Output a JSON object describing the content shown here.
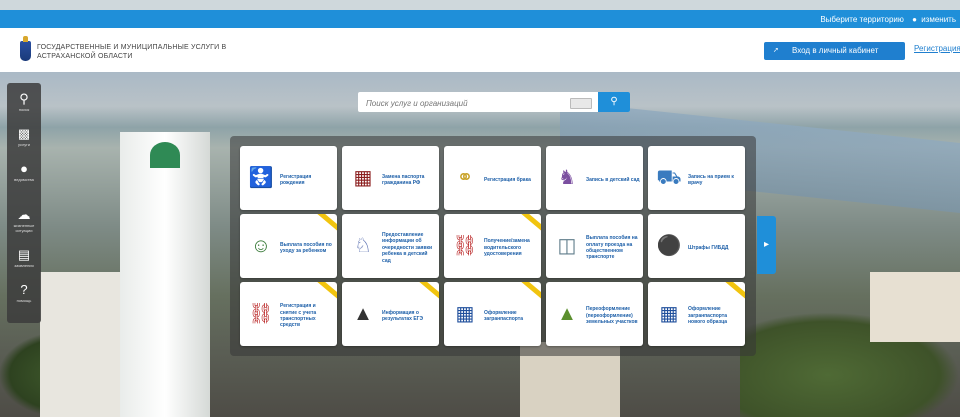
{
  "topbar": {
    "region_label": "Выберите территорию",
    "change_label": "изменить"
  },
  "header": {
    "site_name": "Государственные и муниципальные услуги в Астраханской области",
    "login_label": "Вход в личный кабинет",
    "register_label": "Регистрация"
  },
  "sidebar": {
    "items": [
      {
        "label": "поиск",
        "icon": "search-icon"
      },
      {
        "label": "услуги",
        "icon": "book-icon"
      },
      {
        "label": "ведомства",
        "icon": "globe-icon"
      },
      {
        "label": "жизненные ситуации",
        "icon": "weather-icon"
      },
      {
        "label": "заявления",
        "icon": "document-icon"
      },
      {
        "label": "помощь",
        "icon": "help-icon"
      }
    ]
  },
  "search": {
    "placeholder": "Поиск услуг и организаций"
  },
  "tiles": [
    {
      "label": "Регистрация рождения",
      "icon": "stroller-icon",
      "ribbon": false
    },
    {
      "label": "Замена паспорта гражданина РФ",
      "icon": "passport-icon",
      "ribbon": false
    },
    {
      "label": "Регистрация брака",
      "icon": "rings-icon",
      "ribbon": false
    },
    {
      "label": "Запись в детский сад",
      "icon": "kindergarten-icon",
      "ribbon": false
    },
    {
      "label": "Запись на прием к врачу",
      "icon": "ambulance-icon",
      "ribbon": false
    },
    {
      "label": "Выплата пособия по уходу за ребенком",
      "icon": "family-icon",
      "ribbon": true
    },
    {
      "label": "Предоставление информации об очередности заявки ребенка в детский сад",
      "icon": "rocking-horse-icon",
      "ribbon": false
    },
    {
      "label": "Получение/замена водительского удостоверения",
      "icon": "car-icon",
      "ribbon": true
    },
    {
      "label": "Выплата пособия на оплату проезда на общественном транспорте",
      "icon": "money-icon",
      "ribbon": false
    },
    {
      "label": "Штрафы ГИБДД",
      "icon": "traffic-light-icon",
      "ribbon": false
    },
    {
      "label": "Регистрация и снятие с учета транспортных средств",
      "icon": "car-icon",
      "ribbon": true
    },
    {
      "label": "Информация о результатах ЕГЭ",
      "icon": "graduation-cap-icon",
      "ribbon": true
    },
    {
      "label": "Оформление загранпаспорта",
      "icon": "foreign-passport-icon",
      "ribbon": true
    },
    {
      "label": "Переоформление (переоформление) земельных участков",
      "icon": "land-plot-icon",
      "ribbon": false
    },
    {
      "label": "Оформление загранпаспорта нового образца",
      "icon": "biometric-passport-icon",
      "ribbon": true
    }
  ],
  "carousel": {
    "next_icon": "chevron-right-icon"
  }
}
